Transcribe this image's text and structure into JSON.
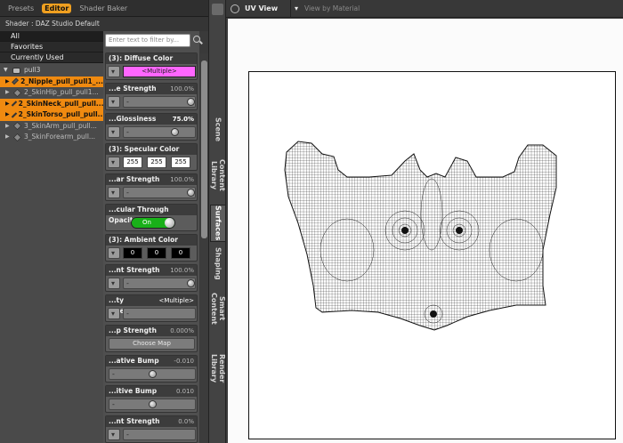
{
  "tabs": {
    "presets": "Presets",
    "editor": "Editor",
    "shader_baker": "Shader Baker"
  },
  "shader_label": "Shader : DAZ Studio Default",
  "categories": [
    "All",
    "Favorites",
    "Currently Used"
  ],
  "tree": {
    "root": "pull3",
    "items": [
      {
        "label": "2_Nipple_pull_pull1_...",
        "highlighted": true
      },
      {
        "label": "2_SkinHip_pull_pull1...",
        "highlighted": false
      },
      {
        "label": "2_SkinNeck_pull_pull...",
        "highlighted": true
      },
      {
        "label": "2_SkinTorso_pull_pull...",
        "highlighted": true
      },
      {
        "label": "3_SkinArm_pull_pull...",
        "highlighted": false
      },
      {
        "label": "3_SkinForearm_pull...",
        "highlighted": false
      }
    ]
  },
  "filter_placeholder": "Enter text to filter by...",
  "properties": {
    "diffuse": {
      "label": "(3): Diffuse Color",
      "value": "<Multiple>",
      "color": "#ff66ff"
    },
    "diffuse_strength": {
      "label": "...e Strength",
      "value": "100.0%",
      "level": 1.0
    },
    "glossiness": {
      "label": "...Glossiness",
      "value": "75.0%",
      "level": 0.75
    },
    "specular": {
      "label": "(3): Specular Color",
      "r": "255",
      "g": "255",
      "b": "255"
    },
    "specular_strength": {
      "label": "...ar Strength",
      "value": "100.0%",
      "level": 1.0
    },
    "through_opacity": {
      "label": "...cular Through Opacity",
      "toggle": "On"
    },
    "ambient": {
      "label": "(3): Ambient Color",
      "r": "0",
      "g": "0",
      "b": "0"
    },
    "ambient_strength": {
      "label": "...nt Strength",
      "value": "100.0%",
      "level": 1.0
    },
    "opacity_strength": {
      "label": "...ty Strength",
      "value": "<Multiple>"
    },
    "bump_strength": {
      "label": "...p Strength",
      "value": "0.000%",
      "button": "Choose Map"
    },
    "negative_bump": {
      "label": "...ative Bump",
      "value": "-0.010",
      "level": 0.5
    },
    "positive_bump": {
      "label": "...itive Bump",
      "value": "0.010",
      "level": 0.5
    },
    "last_strength": {
      "label": "...nt Strength",
      "value": "0.0%"
    }
  },
  "vertical_tabs": [
    "Scene",
    "Content Library",
    "Surfaces",
    "Shaping",
    "Smart Content",
    "Render Library"
  ],
  "uv_view": {
    "title": "UV View",
    "mode": "View by Material"
  },
  "colors": {
    "accent": "#f08a10",
    "toggle_on": "#19b019",
    "diffuse_swatch": "#ff66ff"
  }
}
